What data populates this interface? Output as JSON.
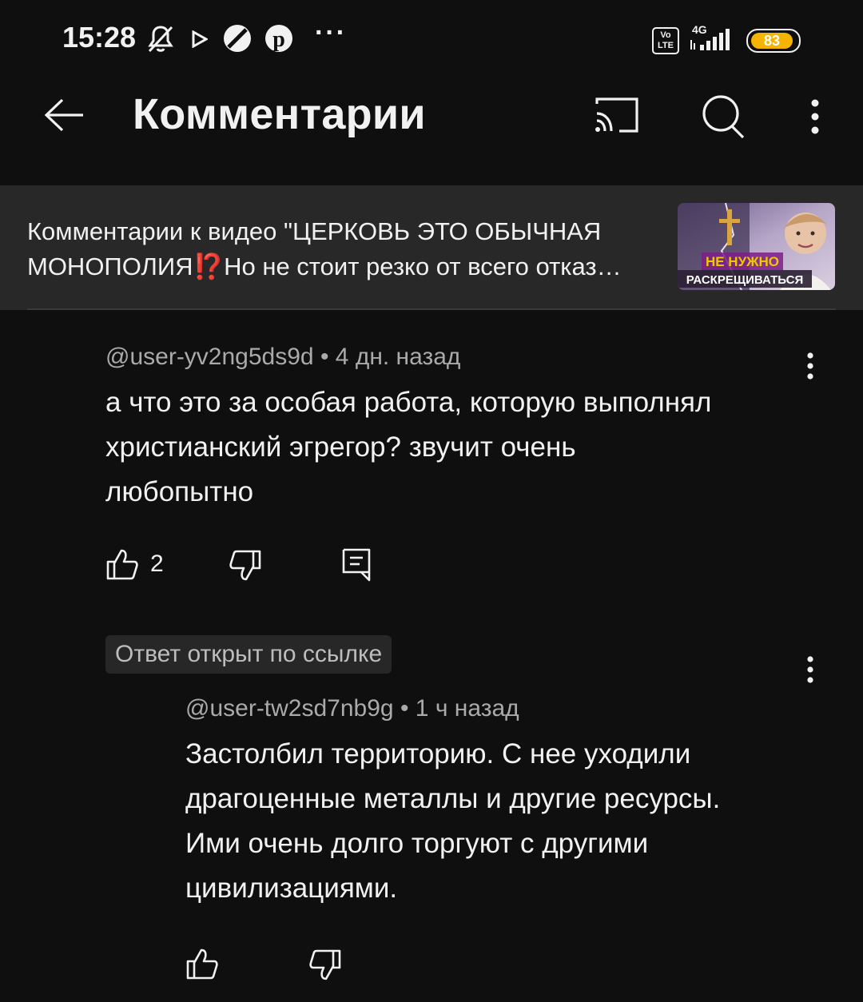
{
  "status_bar": {
    "time": "15:28",
    "network": "4G",
    "volte": "Vo LTE",
    "battery": "83",
    "more": "···"
  },
  "header": {
    "title": "Комментарии",
    "icons": [
      "back-arrow-icon",
      "cast-icon",
      "search-icon",
      "more-vert-icon"
    ]
  },
  "context": {
    "line1": "Комментарии к видео \"ЦЕРКОВЬ ЭТО ОБЫЧНАЯ",
    "line2": "МОНОПОЛИЯ⁉️Но не стоит резко от всего отказ…",
    "thumbnail_text_1": "НЕ НУЖНО",
    "thumbnail_text_2": "РАСКРЕЩИВАТЬСЯ"
  },
  "comment": {
    "author": "@user-yv2ng5ds9d",
    "time": "4 дн. назад",
    "text_lines": [
      "а что это за особая работа, которую выполнял",
      "христианский эгрегор? звучит очень",
      "любопытно"
    ],
    "likes": "2"
  },
  "linked_badge": "Ответ открыт по ссылке",
  "reply": {
    "author": "@user-tw2sd7nb9g",
    "time": "1 ч назад",
    "text_lines": [
      "Застолбил территорию. С нее уходили",
      "драгоценные металлы и другие ресурсы.",
      "Ими очень долго торгуют с другими",
      "цивилизациями."
    ]
  },
  "meta_separator": " • ",
  "colors": {
    "background": "#0f0f0f",
    "banner": "#282828",
    "text": "#f1f1f1",
    "secondary_text": "#aaaaaa",
    "battery": "#f5b400"
  }
}
